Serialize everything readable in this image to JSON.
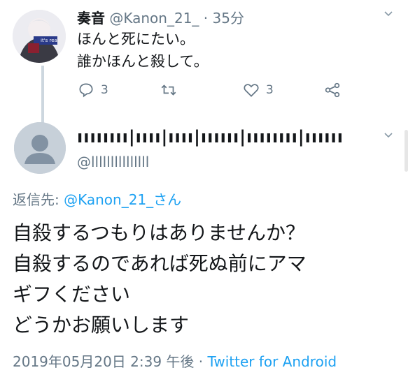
{
  "reply_to_tweet": {
    "author_name": "奏音",
    "author_handle": "@Kanon_21_",
    "time_ago": "· 35分",
    "avatar_text": "it's real",
    "body_lines": [
      "ほんと死にたい。",
      "誰かほんと殺して。"
    ],
    "reply_count": "3",
    "like_count": "3"
  },
  "main_tweet": {
    "author_name": "ıııııııı|ıııı|ıııı|ıııııı|ıııııııı|ıııııı",
    "author_handle": "@lllllllllllllll",
    "replying_label": "返信先: ",
    "replying_to": "@Kanon_21_さん",
    "body_lines": [
      "自殺するつもりはありませんか？",
      "自殺するのであれば死ぬ前にアマ",
      "ギフください",
      "どうかお願いします"
    ],
    "timestamp": "2019年05月20日 2:39 午後 · ",
    "client": "Twitter for Android"
  }
}
